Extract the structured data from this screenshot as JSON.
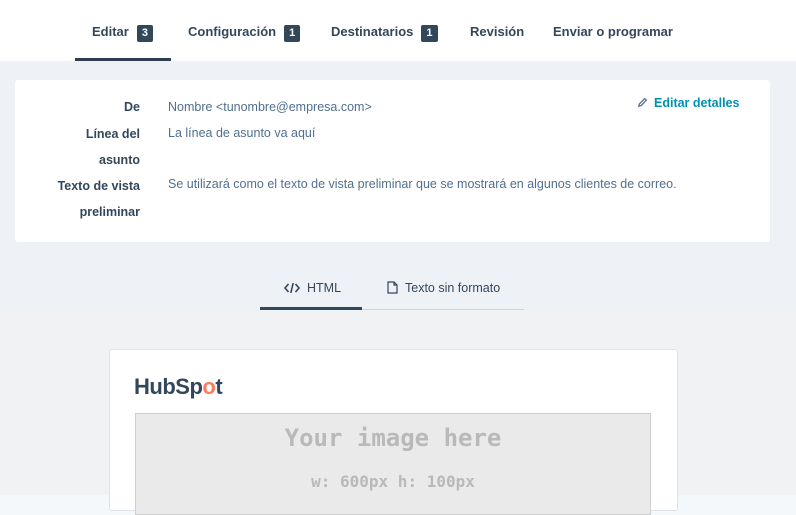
{
  "tabs": [
    {
      "label": "Editar",
      "badge": "3",
      "active": true
    },
    {
      "label": "Configuración",
      "badge": "1"
    },
    {
      "label": "Destinatarios",
      "badge": "1"
    },
    {
      "label": "Revisión"
    },
    {
      "label": "Enviar o programar"
    }
  ],
  "details": {
    "from_label": "De",
    "from_value": "Nombre <tunombre@empresa.com>",
    "subject_label_line1": "Línea del",
    "subject_label_line2": "asunto",
    "subject_value": "La línea de asunto va aquí",
    "preview_label_line1": "Texto de vista",
    "preview_label_line2": "preliminar",
    "preview_value": "Se utilizará como el texto de vista preliminar que se mostrará en algunos clientes de correo.",
    "edit_label": "Editar detalles"
  },
  "view_tabs": [
    {
      "label": "HTML",
      "icon": "code-icon",
      "active": true
    },
    {
      "label": "Texto sin formato",
      "icon": "document-icon"
    }
  ],
  "email": {
    "logo_part1": "HubSp",
    "logo_o": "o",
    "logo_part2": "t",
    "placeholder_title": "Your image here",
    "placeholder_size": "w: 600px  h: 100px"
  },
  "colors": {
    "accent_link": "#0091ae",
    "text_dark": "#33475b",
    "logo_orange": "#ff7a59"
  }
}
